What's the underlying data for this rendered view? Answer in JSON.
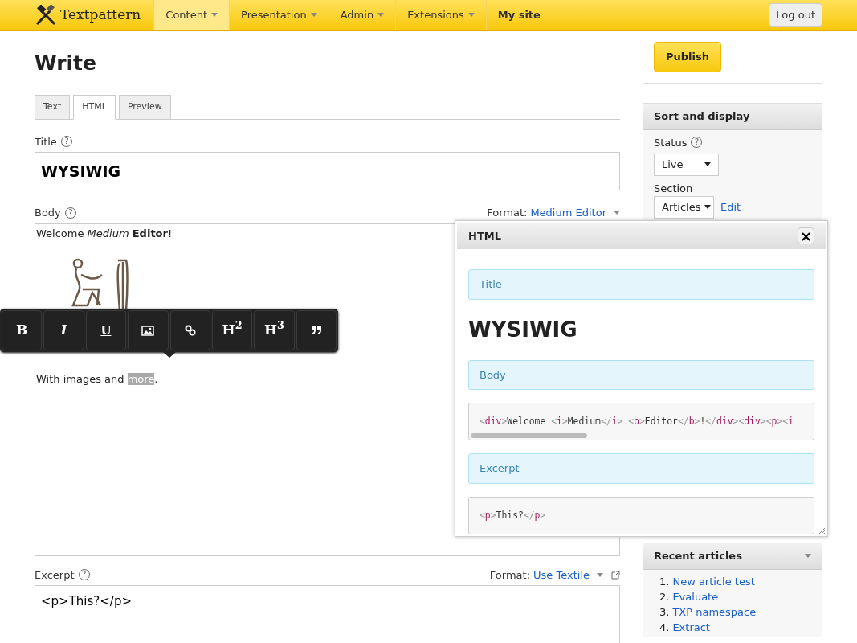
{
  "brand": {
    "name": "Textpattern"
  },
  "nav": [
    {
      "label": "Content",
      "dropdown": true,
      "selected": true
    },
    {
      "label": "Presentation",
      "dropdown": true,
      "selected": false
    },
    {
      "label": "Admin",
      "dropdown": true,
      "selected": false
    },
    {
      "label": "Extensions",
      "dropdown": true,
      "selected": false
    },
    {
      "label": "My site",
      "dropdown": false,
      "selected": false
    }
  ],
  "logout": "Log out",
  "page_title": "Write",
  "tabs": [
    {
      "label": "Text",
      "selected": false
    },
    {
      "label": "HTML",
      "selected": true
    },
    {
      "label": "Preview",
      "selected": false
    }
  ],
  "title_field": {
    "label": "Title",
    "help": "?",
    "value": "WYSIWIG"
  },
  "body": {
    "label": "Body",
    "help": "?",
    "format_label": "Format:",
    "format": "Medium Editor",
    "first_line": "Welcome *Medium* **Editor**!",
    "last_line": {
      "before": "With images and ",
      "selected": "more",
      "after": "."
    }
  },
  "toolbar": [
    {
      "kind": "bold",
      "label": "B"
    },
    {
      "kind": "italic",
      "label": "I"
    },
    {
      "kind": "underline",
      "label": "U"
    },
    {
      "kind": "image"
    },
    {
      "kind": "link"
    },
    {
      "kind": "heading",
      "label": "H$^{2}$"
    },
    {
      "kind": "heading",
      "label": "H$^{3}$"
    },
    {
      "kind": "quote"
    }
  ],
  "excerpt": {
    "label": "Excerpt",
    "help": "?",
    "format_label": "Format:",
    "format": "Use Textile",
    "value": "<p>This?</p>"
  },
  "publish": "Publish",
  "sort_display": {
    "title": "Sort and display",
    "status_label": "Status",
    "help": "?",
    "status": "Live",
    "section_label": "Section",
    "section": "Articles",
    "edit": "Edit"
  },
  "recent": {
    "title": "Recent articles",
    "items": [
      {
        "number": "1.",
        "title": "New article test"
      },
      {
        "number": "2.",
        "title": "Evaluate"
      },
      {
        "number": "3.",
        "title": "TXP namespace"
      },
      {
        "number": "4.",
        "title": "Extract"
      }
    ]
  },
  "popup": {
    "title": "HTML",
    "close": "×",
    "sections": [
      {
        "kind": "heading",
        "text": "Title"
      },
      {
        "kind": "title",
        "text": "WYSIWIG"
      },
      {
        "kind": "heading",
        "text": "Body"
      },
      {
        "kind": "code",
        "text": "<div>Welcome <i>Medium</i> <b>Editor</b>!</div><div><p><i",
        "scroll": true
      },
      {
        "kind": "heading",
        "text": "Excerpt"
      },
      {
        "kind": "code",
        "text": "<p>This?</p>",
        "scroll": false
      }
    ]
  }
}
